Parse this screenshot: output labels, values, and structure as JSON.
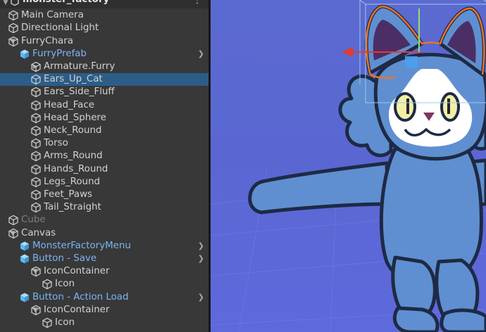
{
  "hierarchy": {
    "scene_name": "monster_factory",
    "menu_glyph": "⋮",
    "rows": [
      {
        "label": "Main Camera",
        "depth": 1,
        "fold": "",
        "icon": "gameobject-icon",
        "type": "normal"
      },
      {
        "label": "Directional Light",
        "depth": 1,
        "fold": "",
        "icon": "gameobject-icon",
        "type": "normal"
      },
      {
        "label": "FurryChara",
        "depth": 1,
        "fold": "▼",
        "icon": "gameobject-icon",
        "type": "normal"
      },
      {
        "label": "FurryPrefab",
        "depth": 2,
        "fold": "▼",
        "icon": "prefab-icon",
        "type": "prefab",
        "more": true
      },
      {
        "label": "Armature.Furry",
        "depth": 3,
        "fold": "▶",
        "icon": "gameobject-icon",
        "type": "normal"
      },
      {
        "label": "Ears_Up_Cat",
        "depth": 3,
        "fold": "",
        "icon": "gameobject-icon",
        "type": "selected"
      },
      {
        "label": "Ears_Side_Fluff",
        "depth": 3,
        "fold": "",
        "icon": "gameobject-icon",
        "type": "normal"
      },
      {
        "label": "Head_Face",
        "depth": 3,
        "fold": "",
        "icon": "gameobject-icon",
        "type": "normal"
      },
      {
        "label": "Head_Sphere",
        "depth": 3,
        "fold": "",
        "icon": "gameobject-icon",
        "type": "normal"
      },
      {
        "label": "Neck_Round",
        "depth": 3,
        "fold": "",
        "icon": "gameobject-icon",
        "type": "normal"
      },
      {
        "label": "Torso",
        "depth": 3,
        "fold": "",
        "icon": "gameobject-icon",
        "type": "normal"
      },
      {
        "label": "Arms_Round",
        "depth": 3,
        "fold": "",
        "icon": "gameobject-icon",
        "type": "normal"
      },
      {
        "label": "Hands_Round",
        "depth": 3,
        "fold": "",
        "icon": "gameobject-icon",
        "type": "normal"
      },
      {
        "label": "Legs_Round",
        "depth": 3,
        "fold": "",
        "icon": "gameobject-icon",
        "type": "normal"
      },
      {
        "label": "Feet_Paws",
        "depth": 3,
        "fold": "",
        "icon": "gameobject-icon",
        "type": "normal"
      },
      {
        "label": "Tail_Straight",
        "depth": 3,
        "fold": "",
        "icon": "gameobject-icon",
        "type": "normal"
      },
      {
        "label": "Cube",
        "depth": 1,
        "fold": "",
        "icon": "gameobject-icon",
        "type": "inactive"
      },
      {
        "label": "Canvas",
        "depth": 1,
        "fold": "▼",
        "icon": "gameobject-icon",
        "type": "normal"
      },
      {
        "label": "MonsterFactoryMenu",
        "depth": 2,
        "fold": "▶",
        "icon": "prefab-icon",
        "type": "prefab",
        "more": true
      },
      {
        "label": "Button - Save",
        "depth": 2,
        "fold": "▼",
        "icon": "prefab-icon",
        "type": "prefab",
        "more": true
      },
      {
        "label": "IconContainer",
        "depth": 3,
        "fold": "▼",
        "icon": "gameobject-icon",
        "type": "normal"
      },
      {
        "label": "Icon",
        "depth": 4,
        "fold": "",
        "icon": "gameobject-icon",
        "type": "normal"
      },
      {
        "label": "Button - Action Load",
        "depth": 2,
        "fold": "▼",
        "icon": "prefab-icon",
        "type": "prefab",
        "more": true
      },
      {
        "label": "IconContainer",
        "depth": 3,
        "fold": "▼",
        "icon": "gameobject-icon",
        "type": "normal"
      },
      {
        "label": "Icon",
        "depth": 4,
        "fold": "",
        "icon": "gameobject-icon",
        "type": "normal"
      }
    ]
  },
  "colors": {
    "panel_bg": "#383838",
    "selection": "#2c5d87",
    "prefab_text": "#7bb4f4",
    "scene_bg": "#5b6ad0",
    "character_blue": "#5f8fd0",
    "selection_outline": "#e8742a",
    "eye_yellow": "#f1f0a6"
  },
  "scene": {
    "gizmo_x_axis_color": "#e33b2f",
    "gizmo_y_axis_color": "#8fe07a"
  }
}
